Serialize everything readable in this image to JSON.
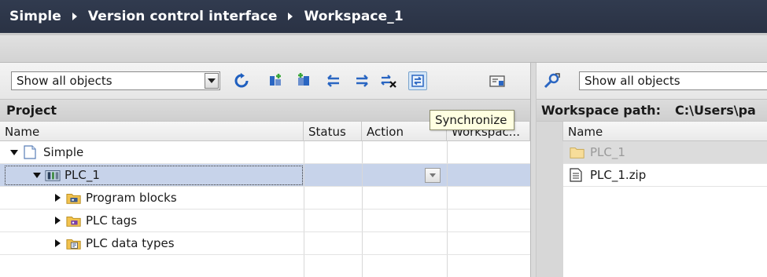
{
  "breadcrumb": [
    "Simple",
    "Version control interface",
    "Workspace_1"
  ],
  "left_panel": {
    "filter": {
      "selected": "Show all objects"
    },
    "toolbar_icons": [
      "refresh-icon",
      "add-to-workspace-icon",
      "add-from-workspace-icon",
      "arrow-left-icon",
      "arrow-right-icon",
      "arrows-delete-icon",
      "synchronize-icon",
      "settings-panel-icon"
    ],
    "title": "Project",
    "columns": [
      "Name",
      "Status",
      "Action",
      "Workspac..."
    ],
    "tree": [
      {
        "label": "Simple",
        "level": 0,
        "expanded": true,
        "icon": "project-icon"
      },
      {
        "label": "PLC_1",
        "level": 1,
        "expanded": true,
        "icon": "plc-icon",
        "selected": true
      },
      {
        "label": "Program blocks",
        "level": 2,
        "expanded": false,
        "icon": "program-blocks-folder-icon"
      },
      {
        "label": "PLC tags",
        "level": 2,
        "expanded": false,
        "icon": "plc-tags-folder-icon"
      },
      {
        "label": "PLC data types",
        "level": 2,
        "expanded": false,
        "icon": "data-types-folder-icon"
      }
    ],
    "tooltip": "Synchronize"
  },
  "right_panel": {
    "filter": {
      "selected": "Show all objects"
    },
    "path_label": "Workspace path:",
    "path_value": "C:\\Users\\pa",
    "columns": [
      "Name"
    ],
    "items": [
      {
        "label": "PLC_1",
        "icon": "folder-icon",
        "selected": true
      },
      {
        "label": "PLC_1.zip",
        "icon": "file-icon"
      }
    ]
  },
  "colors": {
    "titlebar": "#2d3548",
    "selection": "#c7d3ea",
    "tooltip": "#ffffe1"
  }
}
